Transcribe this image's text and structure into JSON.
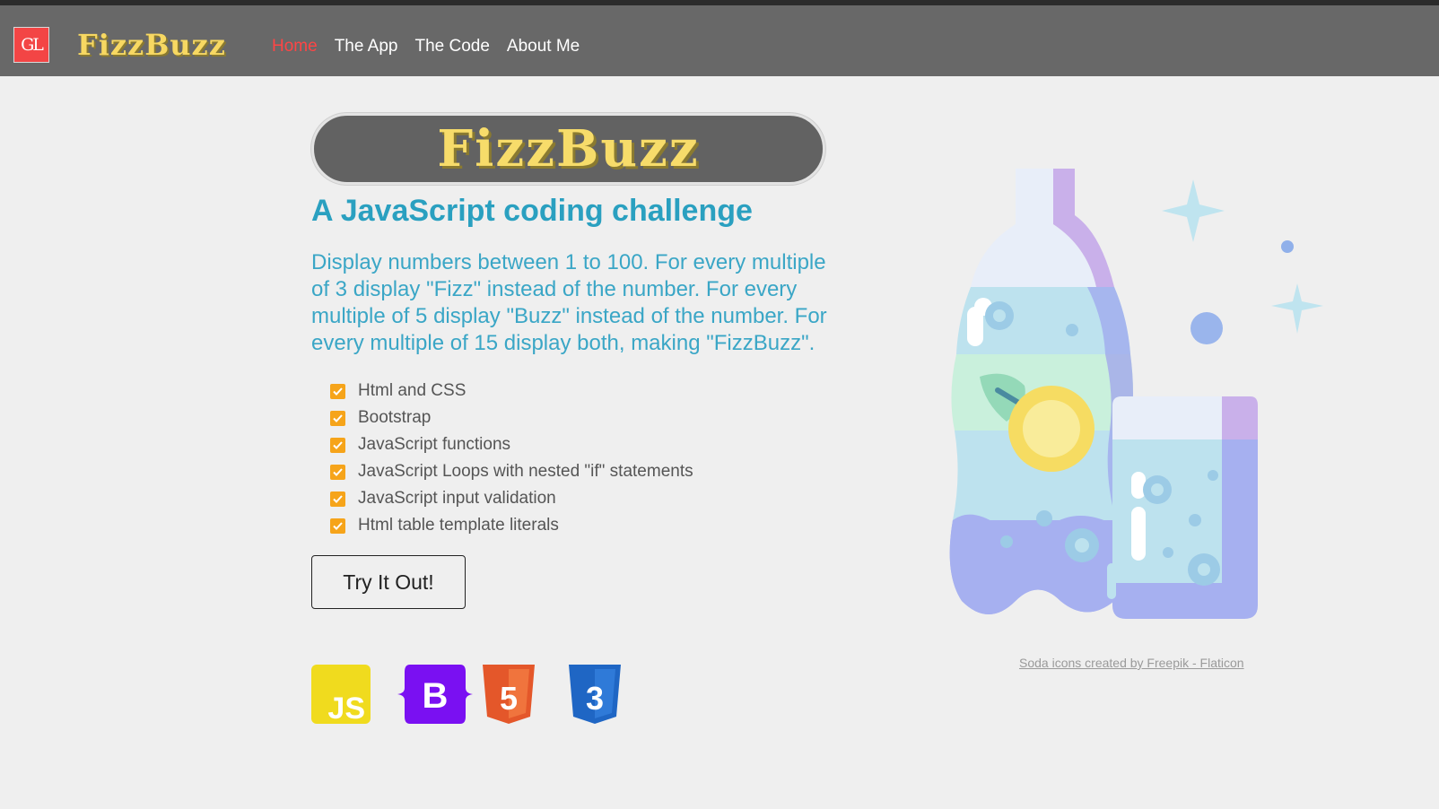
{
  "navbar": {
    "logo_initials": "GL",
    "brand": "FizzBuzz",
    "links": [
      {
        "label": "Home",
        "active": true
      },
      {
        "label": "The App",
        "active": false
      },
      {
        "label": "The Code",
        "active": false
      },
      {
        "label": "About Me",
        "active": false
      }
    ]
  },
  "hero": {
    "badge": "FizzBuzz",
    "subtitle": "A JavaScript coding challenge",
    "description": "Display numbers between 1 to 100. For every multiple of 3 display \"Fizz\" instead of the number. For every multiple of 5 display \"Buzz\" instead of the number. For every multiple of 15 display both, making \"FizzBuzz\".",
    "features": [
      "Html and CSS",
      "Bootstrap",
      "JavaScript functions",
      "JavaScript Loops with nested \"if\" statements",
      "JavaScript input validation",
      "Html table template literals"
    ],
    "cta_label": "Try It Out!"
  },
  "tech_icons": [
    {
      "name": "javascript-icon",
      "label": "JS",
      "color": "#f0db1e"
    },
    {
      "name": "bootstrap-icon",
      "label": "B",
      "color": "#7a10f2"
    },
    {
      "name": "html5-icon",
      "label": "5",
      "color": "#e4572a"
    },
    {
      "name": "css3-icon",
      "label": "3",
      "color": "#1f66c4"
    }
  ],
  "illustration": {
    "icon": "soda-bottle-glass-illustration"
  },
  "credit": "Soda icons created by Freepik - Flaticon",
  "colors": {
    "navbar": "#686868",
    "accent": "#2aa0c0",
    "active_link": "#ff4545",
    "brand_yellow": "#f7d862",
    "check": "#f6a41a"
  }
}
